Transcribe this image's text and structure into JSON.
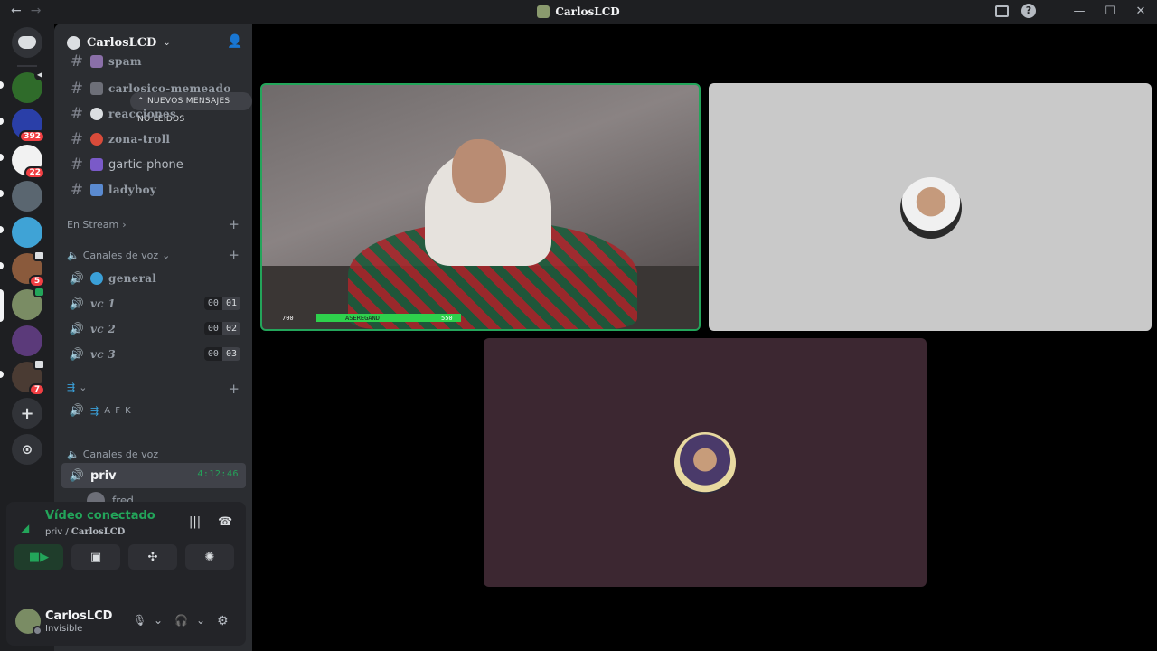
{
  "window": {
    "title": "CarlosLCD",
    "nav_back": "←",
    "nav_forward": "→",
    "help_glyph": "?",
    "controls": [
      "—",
      "☐",
      "✕"
    ]
  },
  "rail": {
    "badges": {
      "server2": "392",
      "server3": "22",
      "server6": "5",
      "server10": "7"
    },
    "add_server": "+",
    "discover": "⊙"
  },
  "sidebar": {
    "guild_name": "CarlosLCD",
    "unread_banner": "⌃ NUEVOS MENSAJES NO LEÍDOS",
    "channels_top": [
      {
        "name": "spam"
      },
      {
        "name": "carlosico-memeado"
      },
      {
        "name": "reacciones"
      },
      {
        "name": "zona-troll"
      },
      {
        "name": "gartic-phone"
      },
      {
        "name": "ladyboy"
      }
    ],
    "category_stream": "En Stream",
    "category_voice": "Canales de voz",
    "voice_channels": [
      {
        "name": "general"
      },
      {
        "name": "vc 1",
        "count_a": "00",
        "count_b": "01"
      },
      {
        "name": "vc 2",
        "count_a": "00",
        "count_b": "02"
      },
      {
        "name": "vc 3",
        "count_a": "00",
        "count_b": "03"
      }
    ],
    "category_afk_icon": "⇶",
    "afk_channel": "A F K",
    "category_voice2": "Canales de voz",
    "active_channel": {
      "name": "priv",
      "timer": "4:12:46"
    },
    "voice_users": [
      {
        "name": "fred"
      }
    ]
  },
  "voice_panel": {
    "status": "Vídeo conectado",
    "channel": "priv /",
    "guild": "CarlosLCD"
  },
  "user_panel": {
    "name": "CarlosLCD",
    "status": "Invisible"
  },
  "stage": {
    "hud_left": "700",
    "hud_mid": "ASEREGAND",
    "hud_right": "550"
  }
}
